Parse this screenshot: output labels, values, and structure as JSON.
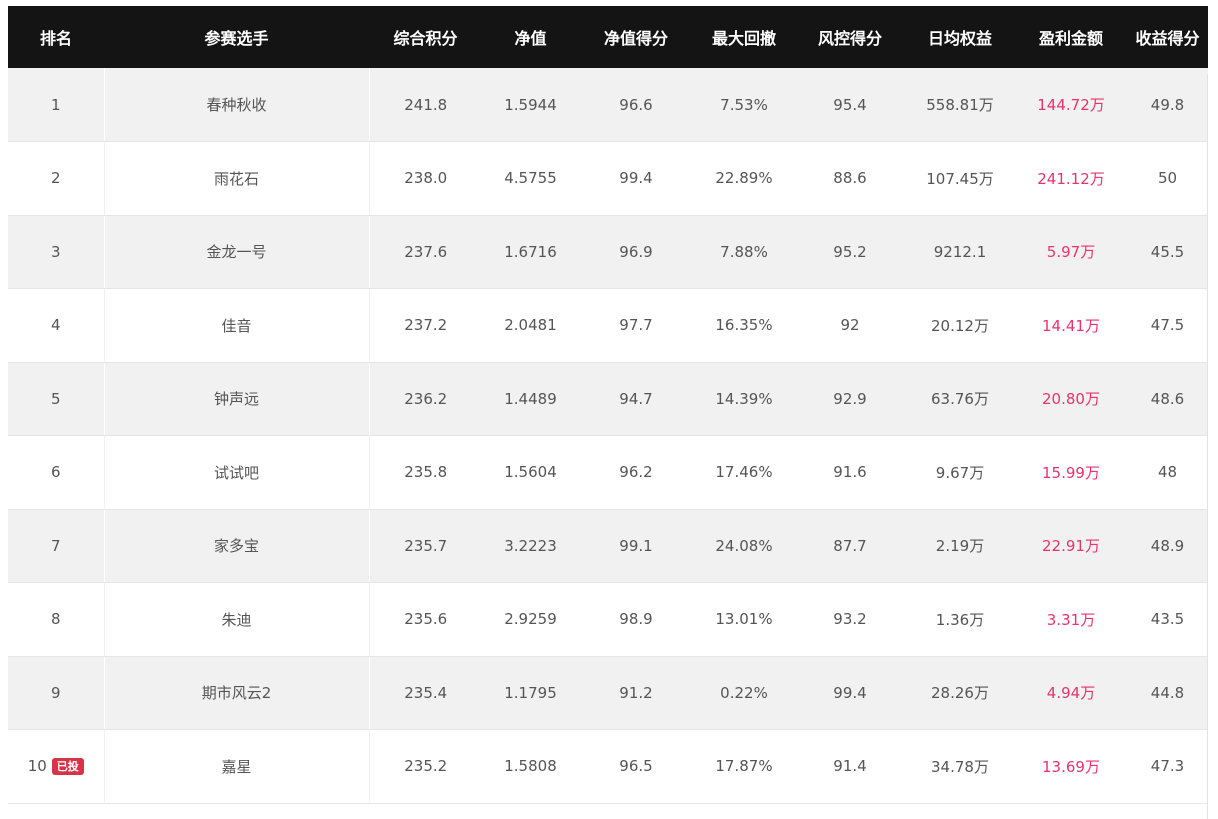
{
  "columns": [
    "排名",
    "参赛选手",
    "综合积分",
    "净值",
    "净值得分",
    "最大回撤",
    "风控得分",
    "日均权益",
    "盈利金额",
    "收益得分"
  ],
  "rows": [
    {
      "rank": "1",
      "badge": "",
      "name": "春种秋收",
      "score": "241.8",
      "nav": "1.5944",
      "nav_score": "96.6",
      "max_drawdown": "7.53%",
      "risk_score": "95.4",
      "avg_equity": "558.81万",
      "profit": "144.72万",
      "return_score": "49.8"
    },
    {
      "rank": "2",
      "badge": "",
      "name": "雨花石",
      "score": "238.0",
      "nav": "4.5755",
      "nav_score": "99.4",
      "max_drawdown": "22.89%",
      "risk_score": "88.6",
      "avg_equity": "107.45万",
      "profit": "241.12万",
      "return_score": "50"
    },
    {
      "rank": "3",
      "badge": "",
      "name": "金龙一号",
      "score": "237.6",
      "nav": "1.6716",
      "nav_score": "96.9",
      "max_drawdown": "7.88%",
      "risk_score": "95.2",
      "avg_equity": "9212.1",
      "profit": "5.97万",
      "return_score": "45.5"
    },
    {
      "rank": "4",
      "badge": "",
      "name": "佳音",
      "score": "237.2",
      "nav": "2.0481",
      "nav_score": "97.7",
      "max_drawdown": "16.35%",
      "risk_score": "92",
      "avg_equity": "20.12万",
      "profit": "14.41万",
      "return_score": "47.5"
    },
    {
      "rank": "5",
      "badge": "",
      "name": "钟声远",
      "score": "236.2",
      "nav": "1.4489",
      "nav_score": "94.7",
      "max_drawdown": "14.39%",
      "risk_score": "92.9",
      "avg_equity": "63.76万",
      "profit": "20.80万",
      "return_score": "48.6"
    },
    {
      "rank": "6",
      "badge": "",
      "name": "试试吧",
      "score": "235.8",
      "nav": "1.5604",
      "nav_score": "96.2",
      "max_drawdown": "17.46%",
      "risk_score": "91.6",
      "avg_equity": "9.67万",
      "profit": "15.99万",
      "return_score": "48"
    },
    {
      "rank": "7",
      "badge": "",
      "name": "家多宝",
      "score": "235.7",
      "nav": "3.2223",
      "nav_score": "99.1",
      "max_drawdown": "24.08%",
      "risk_score": "87.7",
      "avg_equity": "2.19万",
      "profit": "22.91万",
      "return_score": "48.9"
    },
    {
      "rank": "8",
      "badge": "",
      "name": "朱迪",
      "score": "235.6",
      "nav": "2.9259",
      "nav_score": "98.9",
      "max_drawdown": "13.01%",
      "risk_score": "93.2",
      "avg_equity": "1.36万",
      "profit": "3.31万",
      "return_score": "43.5"
    },
    {
      "rank": "9",
      "badge": "",
      "name": "期市风云2",
      "score": "235.4",
      "nav": "1.1795",
      "nav_score": "91.2",
      "max_drawdown": "0.22%",
      "risk_score": "99.4",
      "avg_equity": "28.26万",
      "profit": "4.94万",
      "return_score": "44.8"
    },
    {
      "rank": "10",
      "badge": "已投",
      "name": "嘉星",
      "score": "235.2",
      "nav": "1.5808",
      "nav_score": "96.5",
      "max_drawdown": "17.87%",
      "risk_score": "91.4",
      "avg_equity": "34.78万",
      "profit": "13.69万",
      "return_score": "47.3"
    }
  ],
  "colors": {
    "header_bg": "#141414",
    "row_odd_bg": "#f1f1f1",
    "row_even_bg": "#ffffff",
    "profit_text": "#e8336d",
    "badge_bg": "#d9334a"
  }
}
